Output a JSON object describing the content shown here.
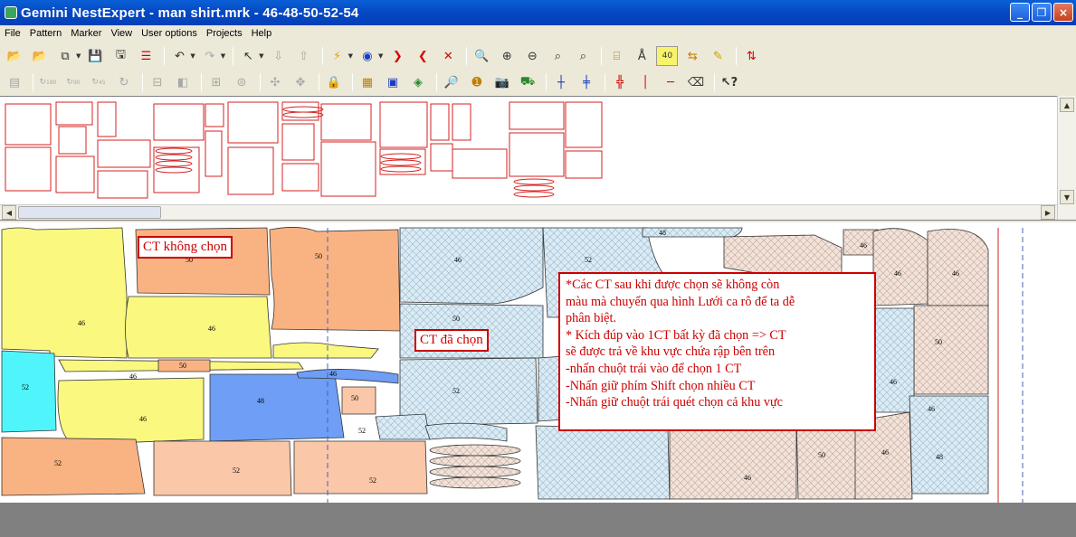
{
  "window": {
    "title": "Gemini NestExpert - man shirt.mrk - 46-48-50-52-54",
    "buttons": [
      "_",
      "❐",
      "×"
    ]
  },
  "menu": [
    "File",
    "Pattern",
    "Marker",
    "View",
    "User options",
    "Projects",
    "Help"
  ],
  "toolbar1": {
    "icons": [
      "open-icon",
      "open-red-icon",
      "copy-icon",
      "save-icon",
      "save-as-icon",
      "layers-icon",
      "undo-icon",
      "redo-icon",
      "pointer-icon",
      "arrow-down-icon",
      "arrow-up-icon",
      "lightning-icon",
      "ring-icon",
      "bracket-left-icon",
      "bracket-right-icon",
      "delete-x-icon",
      "zoom-box-icon",
      "zoom-in-icon",
      "zoom-out-icon",
      "zoom-fit-icon",
      "zoom-width-icon",
      "piece-info-icon",
      "triangle-a-icon",
      "measure-icon",
      "arrows-icon",
      "pencil-icon",
      "toggle-icon"
    ],
    "measure_label": "40"
  },
  "toolbar2": {
    "rotate_labels": [
      "180",
      "90",
      "45"
    ],
    "icons": [
      "table-icon",
      "grid-icon",
      "rotate180-icon",
      "rotate90-icon",
      "rotate45-icon",
      "rotate-icon",
      "align-icon",
      "flip-icon",
      "match-icon",
      "stack-icon",
      "cross-icon",
      "spread-icon",
      "lock-icon",
      "grid-select-icon",
      "fill-icon",
      "fabric-icon",
      "search-icon",
      "badge-icon",
      "capture-icon",
      "truck-icon",
      "vline-icon",
      "hline-icon",
      "split-icon",
      "red-vline-icon",
      "red-hline-icon",
      "eraser-icon",
      "help-icon"
    ]
  },
  "labels": {
    "ct_not_selected": "CT không chọn",
    "ct_selected": "CT đã chọn"
  },
  "note_lines": [
    "*Các CT sau khi được chọn sẽ không còn",
    "màu mà chuyển qua hình Lưới ca rô để ta dễ",
    "phân biệt.",
    "* Kích đúp vào 1CT bất kỳ đã chọn => CT",
    "sẽ được trả về khu vực chứa rập bên trên",
    " -nhấn chuột trái vào để chọn 1 CT",
    " -Nhấn giữ phím Shift chọn nhiều CT",
    " -Nhấn giữ chuột trái quét chọn cả khu vực"
  ],
  "piece_labels": [
    "50",
    "46",
    "46",
    "50",
    "52",
    "46",
    "52",
    "50",
    "46",
    "50",
    "52",
    "50",
    "46",
    "52",
    "52",
    "46",
    "46",
    "50",
    "52",
    "46",
    "50",
    "46",
    "48",
    "48",
    "46",
    "46",
    "46",
    "52",
    "48",
    "46",
    "50",
    "48",
    "52",
    "46",
    "50",
    "46",
    "50",
    "50"
  ],
  "colors": {
    "title_bar": "#0548c2",
    "callout_red": "#cc0000",
    "yellow_piece": "#fbf87f",
    "orange_piece": "#f9b383",
    "pink_piece": "#fbc7a9",
    "cyan_piece": "#4ff5fa",
    "blue_piece": "#6e9ef6",
    "selected_blue": "#d9ecf5",
    "selected_peach": "#f4e2d8"
  }
}
